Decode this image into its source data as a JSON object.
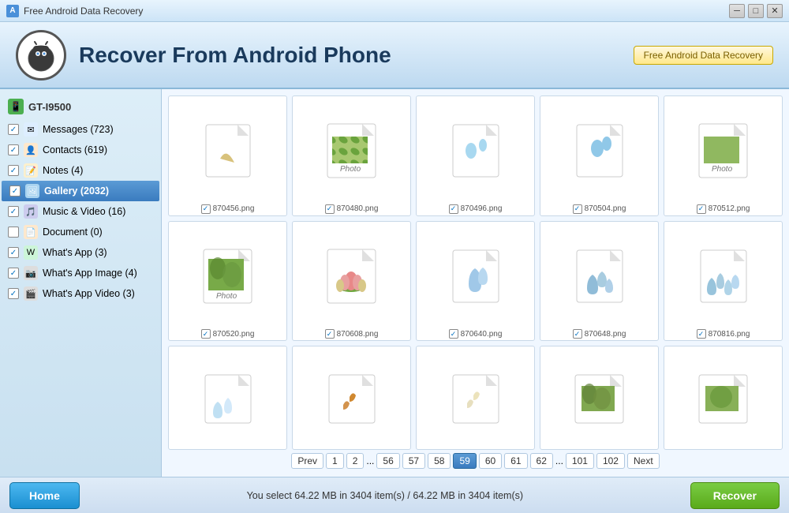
{
  "titlebar": {
    "title": "Free Android Data Recovery",
    "controls": [
      "minimize",
      "maximize",
      "close"
    ]
  },
  "header": {
    "title": "Recover From Android Phone",
    "badge": "Free Android Data Recovery"
  },
  "sidebar": {
    "device": "GT-I9500",
    "items": [
      {
        "id": "messages",
        "label": "Messages (723)",
        "checked": true,
        "color": "#4a90d9",
        "icon": "✉"
      },
      {
        "id": "contacts",
        "label": "Contacts (619)",
        "checked": true,
        "color": "#e07820",
        "icon": "👤"
      },
      {
        "id": "notes",
        "label": "Notes (4)",
        "checked": true,
        "color": "#f0a030",
        "icon": "📝"
      },
      {
        "id": "gallery",
        "label": "Gallery (2032)",
        "checked": true,
        "color": "#5b9bd5",
        "icon": "🖼",
        "active": true
      },
      {
        "id": "musicvideo",
        "label": "Music & Video (16)",
        "checked": true,
        "color": "#2a2a80",
        "icon": "🎵"
      },
      {
        "id": "document",
        "label": "Document (0)",
        "checked": false,
        "color": "#e07820",
        "icon": "📄"
      },
      {
        "id": "whatsapp",
        "label": "What's App (3)",
        "checked": true,
        "color": "#25d366",
        "icon": "W"
      },
      {
        "id": "whatsappimg",
        "label": "What's App Image (4)",
        "checked": true,
        "color": "#555",
        "icon": "📷"
      },
      {
        "id": "whatsappvid",
        "label": "What's App Video (3)",
        "checked": true,
        "color": "#555",
        "icon": "🎬"
      }
    ]
  },
  "grid": {
    "items": [
      {
        "filename": "870456.png",
        "type": "blank"
      },
      {
        "filename": "870480.png",
        "type": "photo"
      },
      {
        "filename": "870496.png",
        "type": "droplets"
      },
      {
        "filename": "870504.png",
        "type": "droplets"
      },
      {
        "filename": "870512.png",
        "type": "photo"
      },
      {
        "filename": "870520.png",
        "type": "photo_leaves"
      },
      {
        "filename": "870608.png",
        "type": "lotus"
      },
      {
        "filename": "870640.png",
        "type": "droplets"
      },
      {
        "filename": "870648.png",
        "type": "droplets"
      },
      {
        "filename": "870816.png",
        "type": "droplets"
      },
      {
        "filename": "",
        "type": "droplets_small"
      },
      {
        "filename": "",
        "type": "leaf_autumn"
      },
      {
        "filename": "",
        "type": "leaf_light"
      },
      {
        "filename": "",
        "type": "photo_leaves"
      },
      {
        "filename": "",
        "type": "photo_leaves2"
      }
    ]
  },
  "pagination": {
    "prev": "Prev",
    "next": "Next",
    "pages": [
      "1",
      "2",
      "...",
      "56",
      "57",
      "58",
      "59",
      "60",
      "61",
      "62",
      "...",
      "101",
      "102"
    ],
    "active": "59"
  },
  "footer": {
    "home_label": "Home",
    "status": "You select 64.22 MB in 3404 item(s) / 64.22 MB in 3404 item(s)",
    "recover_label": "Recover"
  }
}
